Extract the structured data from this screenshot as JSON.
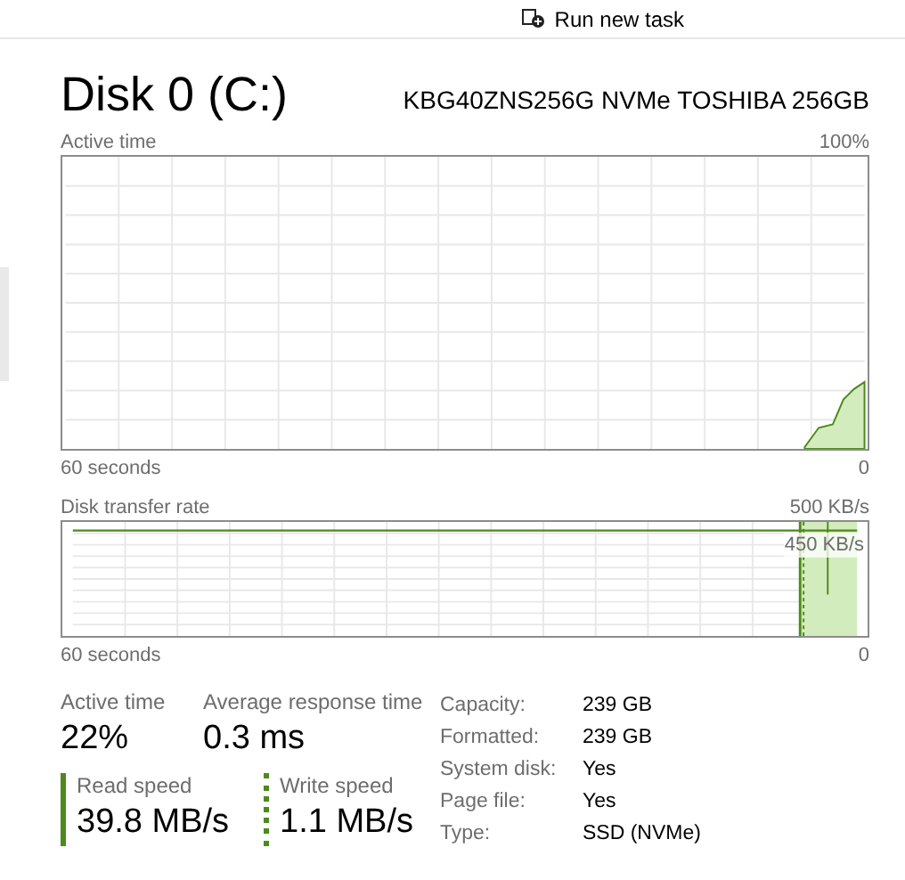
{
  "toolbar": {
    "button": "Run new task"
  },
  "disk": {
    "title": "Disk 0 (C:)",
    "model": "KBG40ZNS256G NVMe TOSHIBA 256GB"
  },
  "charts": [
    {
      "kind": "active",
      "label": "Active time",
      "max": "100%",
      "time": "60 seconds",
      "min": "0"
    },
    {
      "kind": "transfer",
      "label": "Disk transfer rate",
      "max": "500 KB/s",
      "marker": "450 KB/s",
      "time": "60 seconds",
      "min": "0"
    }
  ],
  "stats": [
    {
      "label": "Active time",
      "value": "22%",
      "kind": "plain"
    },
    {
      "label": "Average response time",
      "value": "0.3 ms",
      "kind": "plain"
    },
    {
      "label": "Read speed",
      "value": "39.8 MB/s",
      "kind": "read"
    },
    {
      "label": "Write speed",
      "value": "1.1 MB/s",
      "kind": "write"
    }
  ],
  "properties": [
    {
      "label": "Capacity:",
      "value": "239 GB"
    },
    {
      "label": "Formatted:",
      "value": "239 GB"
    },
    {
      "label": "System disk:",
      "value": "Yes"
    },
    {
      "label": "Page file:",
      "value": "Yes"
    },
    {
      "label": "Type:",
      "value": "SSD (NVMe)"
    }
  ]
}
